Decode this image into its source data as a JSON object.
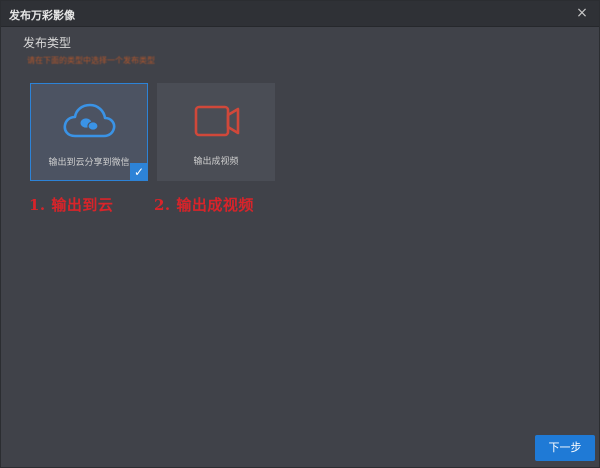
{
  "window": {
    "title": "发布万彩影像",
    "close_label": "×"
  },
  "publish": {
    "section_title": "发布类型",
    "hint": "请在下面的类型中选择一个发布类型",
    "options": [
      {
        "label": "输出到云分享到微信",
        "icon": "cloud-icon",
        "selected": true
      },
      {
        "label": "输出成视频",
        "icon": "video-camera-icon",
        "selected": false
      }
    ],
    "check_glyph": "✓"
  },
  "annotations": {
    "first": "1. 输出到云",
    "second": "2. 输出成视频"
  },
  "footer": {
    "next_label": "下一步"
  },
  "colors": {
    "accent": "#2d83d7",
    "annotation": "#d8242a",
    "video_icon": "#d0483a"
  }
}
